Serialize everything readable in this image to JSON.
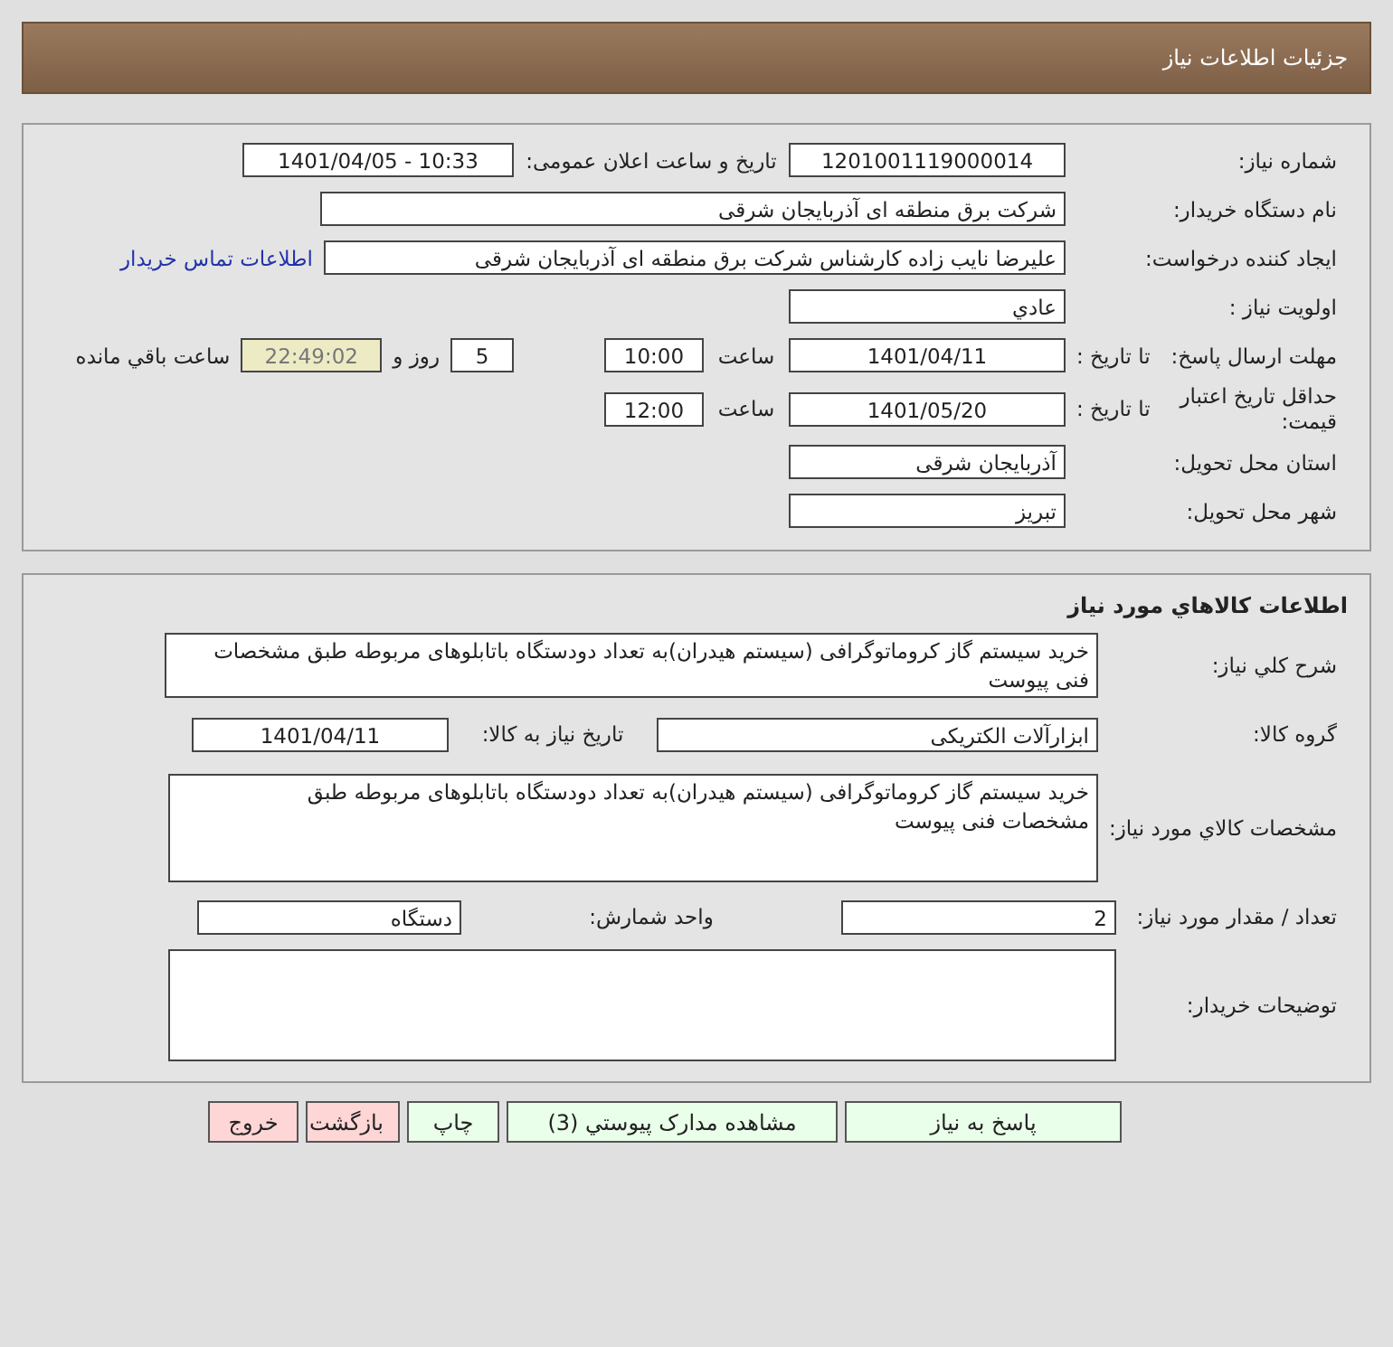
{
  "header": {
    "title": "جزئیات اطلاعات نیاز"
  },
  "need": {
    "need_number": {
      "label": "شماره نیاز:",
      "value": "1201001119000014"
    },
    "announce": {
      "label": "تاریخ و ساعت اعلان عمومی:",
      "value": "1401/04/05 - 10:33"
    },
    "buyer": {
      "label": "نام دستگاه خریدار:",
      "value": "شرکت برق منطقه ای آذربایجان شرقی"
    },
    "requester": {
      "label": "ایجاد کننده درخواست:",
      "value": "علیرضا نایب زاده کارشناس شرکت برق منطقه ای آذربایجان شرقی",
      "link": "اطلاعات تماس خریدار"
    },
    "priority": {
      "label": "اولویت نیاز :",
      "value": "عادي"
    },
    "deadline": {
      "label": "مهلت ارسال پاسخ:",
      "to_date_label": "تا تاریخ :",
      "date": "1401/04/11",
      "time_label": "ساعت",
      "time": "10:00",
      "days": "5",
      "days_label": "روز و",
      "remaining": "22:49:02",
      "remaining_label": "ساعت باقي مانده"
    },
    "validity": {
      "label": "حداقل تاریخ اعتبار قیمت:",
      "to_date_label": "تا تاریخ :",
      "date": "1401/05/20",
      "time_label": "ساعت",
      "time": "12:00"
    },
    "province": {
      "label": "استان محل تحویل:",
      "value": "آذربایجان شرقی"
    },
    "city": {
      "label": "شهر محل تحویل:",
      "value": "تبریز"
    }
  },
  "goods": {
    "title": "اطلاعات كالاهاي مورد نیاز",
    "summary": {
      "label": "شرح کلي نياز:",
      "value": "خرید سیستم گاز کروماتوگرافی (سیستم هیدران)به تعداد دودستگاه باتابلوهای مربوطه طبق مشخصات فنی پیوست"
    },
    "group": {
      "label": "گروه کالا:",
      "value": "ابزارآلات الکتریکی",
      "date_label": "تاریخ نیاز به کالا:",
      "date": "1401/04/11"
    },
    "spec": {
      "label": "مشخصات کالاي مورد نياز:",
      "value": "خرید سیستم گاز کروماتوگرافی (سیستم هیدران)به تعداد دودستگاه باتابلوهای مربوطه طبق مشخصات فنی پیوست"
    },
    "quantity": {
      "label": "تعداد / مقدار مورد نیاز:",
      "value": "2",
      "unit_label": "واحد شمارش:",
      "unit": "دستگاه"
    },
    "buyer_notes": {
      "label": "توضیحات خریدار:"
    }
  },
  "buttons": [
    {
      "label": "پاسخ به نیاز",
      "kind": "primary"
    },
    {
      "label": "مشاهده مدارک پیوستي (3)",
      "kind": "primary"
    },
    {
      "label": "چاپ",
      "kind": "primary"
    },
    {
      "label": "بازگشت",
      "kind": "danger"
    },
    {
      "label": "خروج",
      "kind": "danger"
    }
  ]
}
